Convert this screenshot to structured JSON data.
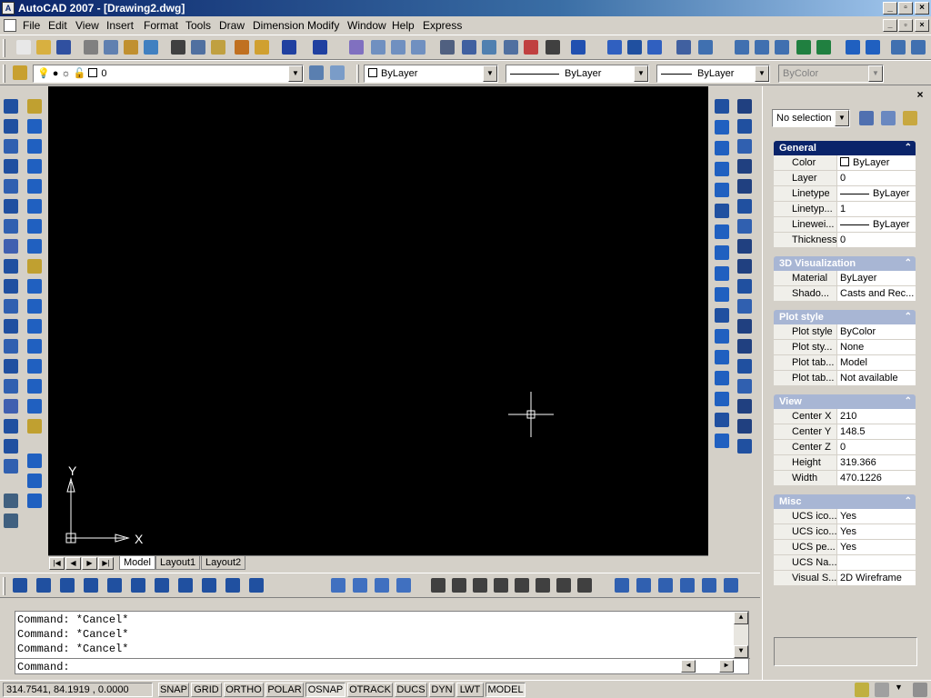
{
  "window": {
    "title": "AutoCAD 2007 - [Drawing2.dwg]",
    "app_icon_label": "A",
    "min": "_",
    "max": "▫",
    "close": "×"
  },
  "menu": {
    "items": [
      "File",
      "Edit",
      "View",
      "Insert",
      "Format",
      "Tools",
      "Draw",
      "Dimension",
      "Modify",
      "Window",
      "Help",
      "Express"
    ],
    "doc_min": "_",
    "doc_restore": "▫",
    "doc_close": "×"
  },
  "properties_toolbar": {
    "layer": "0",
    "color": "ByLayer",
    "linetype": "ByLayer",
    "lineweight": "ByLayer",
    "plotstyle": "ByColor"
  },
  "icons": {
    "standard": [
      "new-icon",
      "open-icon",
      "save-icon",
      "plot-icon",
      "plot-preview-icon",
      "publish-icon",
      "3d-dwf-icon",
      "cut-icon",
      "copy-icon",
      "paste-icon",
      "match-properties-icon",
      "block-editor-icon",
      "undo-icon",
      "redo-icon",
      "pan-icon",
      "zoom-realtime-icon",
      "zoom-window-icon",
      "zoom-previous-icon",
      "properties-icon",
      "design-center-icon",
      "tool-palettes-icon",
      "sheet-set-icon",
      "markup-icon",
      "quickcalc-icon",
      "help-icon",
      "ws-icon1",
      "ws-icon2",
      "ws-icon3",
      "ws-icon4",
      "ws-icon5",
      "zoom1-icon",
      "zoom2-icon",
      "zoom3-icon",
      "zoom4-icon",
      "zoom5-icon",
      "zoom-in-icon",
      "zoom-out-icon",
      "zoom-all-icon",
      "zoom-extents-icon"
    ],
    "layers": [
      "layer-manager-icon",
      "make-current-icon",
      "layer-previous-icon"
    ],
    "draw": [
      "line-icon",
      "construction-line-icon",
      "polyline-icon",
      "polygon-icon",
      "rectangle-icon",
      "arc-icon",
      "circle-icon",
      "revision-cloud-icon",
      "spline-icon",
      "ellipse-icon",
      "ellipse-arc-icon",
      "insert-block-icon",
      "make-block-icon",
      "point-icon",
      "hatch-icon",
      "gradient-icon",
      "region-icon",
      "table-icon",
      "mtext-icon"
    ],
    "draw_extra": [
      "ucs-icon",
      "ucs-world-icon"
    ],
    "modify": [
      "erase-icon",
      "copy-object-icon",
      "mirror-icon",
      "offset-icon",
      "array-icon",
      "move-icon",
      "rotate-icon",
      "scale-icon",
      "stretch-icon",
      "trim-icon",
      "extend-icon",
      "break-at-point-icon",
      "break-icon",
      "join-icon",
      "chamfer-icon",
      "fillet-icon",
      "explode-icon"
    ],
    "modify_extra": [
      "edit-text-icon",
      "edit-hatch-icon",
      "edit-image-icon"
    ],
    "osnap": [
      "temp-track-icon",
      "snap-from-icon",
      "snap-endpoint-icon",
      "snap-midpoint-icon",
      "snap-intersection-icon",
      "snap-apparent-icon",
      "snap-extension-icon",
      "snap-center-icon",
      "snap-quadrant-icon",
      "snap-tangent-icon",
      "snap-perpendicular-icon",
      "snap-parallel-icon",
      "snap-insert-icon",
      "snap-node-icon",
      "snap-nearest-icon",
      "snap-none-icon",
      "osnap-settings-icon"
    ],
    "dimension": [
      "linear-dim-icon",
      "aligned-dim-icon",
      "arc-length-icon",
      "ordinate-dim-icon",
      "radius-dim-icon",
      "jogged-dim-icon",
      "diameter-dim-icon",
      "angular-dim-icon",
      "quick-dim-icon",
      "baseline-dim-icon",
      "continue-dim-icon",
      "quick-leader-icon",
      "tolerance-icon",
      "center-mark-icon",
      "dim-edit-icon",
      "dim-text-edit-icon",
      "dim-update-icon",
      "dim-style-icon"
    ],
    "bottom_ucs": [
      "ucs-a-icon",
      "ucs-b-icon",
      "ucs-c-icon",
      "ucs-d-icon",
      "ucs-e-icon",
      "ucs-f-icon",
      "ucs-g-icon",
      "ucs-h-icon",
      "ucs-i-icon",
      "ucs-j-icon",
      "ucs-k-icon"
    ],
    "bottom_draworder": [
      "bring-front-icon",
      "send-back-icon",
      "bring-above-icon",
      "send-under-icon"
    ],
    "bottom_text": [
      "text-a-icon",
      "text-b-icon",
      "text-c-icon",
      "text-d-icon",
      "text-e-icon",
      "text-f-icon",
      "text-g-icon",
      "text-h-icon"
    ],
    "bottom_misc": [
      "misc-a-icon",
      "misc-b-icon",
      "misc-c-icon",
      "misc-d-icon",
      "misc-e-icon",
      "misc-f-icon"
    ]
  },
  "canvas": {
    "background": "#000000",
    "ucs_x_label": "X",
    "ucs_y_label": "Y"
  },
  "nav": {
    "first": "|◀",
    "prev": "◀",
    "next": "▶",
    "last": "▶|"
  },
  "layout_tabs": [
    "Model",
    "Layout1",
    "Layout2"
  ],
  "command": {
    "history": [
      "Command: *Cancel*",
      "Command: *Cancel*",
      "Command: *Cancel*"
    ],
    "prompt": "Command:",
    "up": "▲",
    "down": "▼",
    "left": "◀",
    "right": "▶"
  },
  "status": {
    "coords": "314.7541, 84.1919 , 0.0000",
    "buttons": [
      "SNAP",
      "GRID",
      "ORTHO",
      "POLAR",
      "OSNAP",
      "OTRACK",
      "DUCS",
      "DYN",
      "LWT",
      "MODEL"
    ],
    "active": [
      "OSNAP",
      "MODEL"
    ]
  },
  "palette": {
    "close": "×",
    "selection": "No selection",
    "collapse_glyph": "⌃",
    "sections": [
      {
        "title": "General",
        "rows": [
          {
            "name": "Color",
            "value": "ByLayer",
            "swatch": true
          },
          {
            "name": "Layer",
            "value": "0"
          },
          {
            "name": "Linetype",
            "value": "ByLayer",
            "line": true
          },
          {
            "name": "Linetyp...",
            "value": "1"
          },
          {
            "name": "Linewei...",
            "value": "ByLayer",
            "line": true
          },
          {
            "name": "Thickness",
            "value": "0"
          }
        ]
      },
      {
        "title": "3D Visualization",
        "rows": [
          {
            "name": "Material",
            "value": "ByLayer"
          },
          {
            "name": "Shado...",
            "value": "Casts and Rec..."
          }
        ]
      },
      {
        "title": "Plot style",
        "rows": [
          {
            "name": "Plot style",
            "value": "ByColor"
          },
          {
            "name": "Plot sty...",
            "value": "None"
          },
          {
            "name": "Plot tab...",
            "value": "Model"
          },
          {
            "name": "Plot tab...",
            "value": "Not available"
          }
        ]
      },
      {
        "title": "View",
        "rows": [
          {
            "name": "Center X",
            "value": "210"
          },
          {
            "name": "Center Y",
            "value": "148.5"
          },
          {
            "name": "Center Z",
            "value": "0"
          },
          {
            "name": "Height",
            "value": "319.366"
          },
          {
            "name": "Width",
            "value": "470.1226"
          }
        ]
      },
      {
        "title": "Misc",
        "rows": [
          {
            "name": "UCS ico...",
            "value": "Yes"
          },
          {
            "name": "UCS ico...",
            "value": "Yes"
          },
          {
            "name": "UCS pe...",
            "value": "Yes"
          },
          {
            "name": "UCS Na...",
            "value": ""
          },
          {
            "name": "Visual S...",
            "value": "2D Wireframe"
          }
        ]
      }
    ]
  }
}
